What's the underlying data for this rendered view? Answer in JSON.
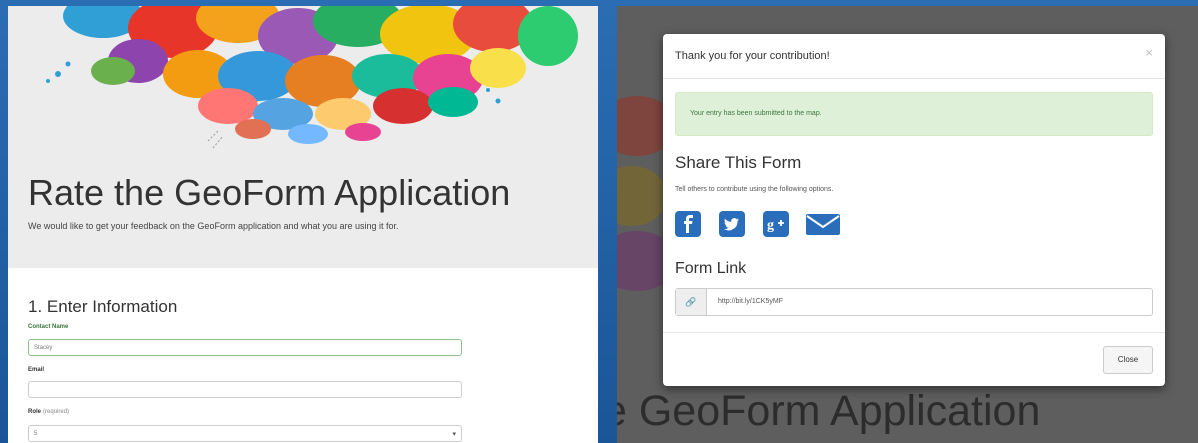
{
  "form_page": {
    "title": "Rate the GeoForm Application",
    "subtitle": "We would like to get your feedback on the GeoForm application and what you are using it for.",
    "section_heading": "1. Enter Information",
    "fields": {
      "contact_name": {
        "label": "Contact Name",
        "value": "Stacey"
      },
      "email": {
        "label": "Email",
        "value": ""
      },
      "role": {
        "label": "Role",
        "required_note": "(required)",
        "value": "5"
      }
    }
  },
  "background_title": "e GeoForm Application",
  "modal": {
    "title": "Thank you for your contribution!",
    "close_symbol": "×",
    "alert": "Your entry has been submitted to the map.",
    "share_heading": "Share This Form",
    "share_text": "Tell others to contribute using the following options.",
    "share_icons": [
      "facebook-icon",
      "twitter-icon",
      "google-plus-icon",
      "email-icon"
    ],
    "form_link_heading": "Form Link",
    "form_link_value": "http://bit.ly/1CK5yMF",
    "close_button": "Close"
  },
  "colors": {
    "social_blue": "#2a6ebb",
    "alert_bg": "#dff0d8",
    "alert_text": "#3c763d",
    "overlay": "#5e5e5e"
  }
}
